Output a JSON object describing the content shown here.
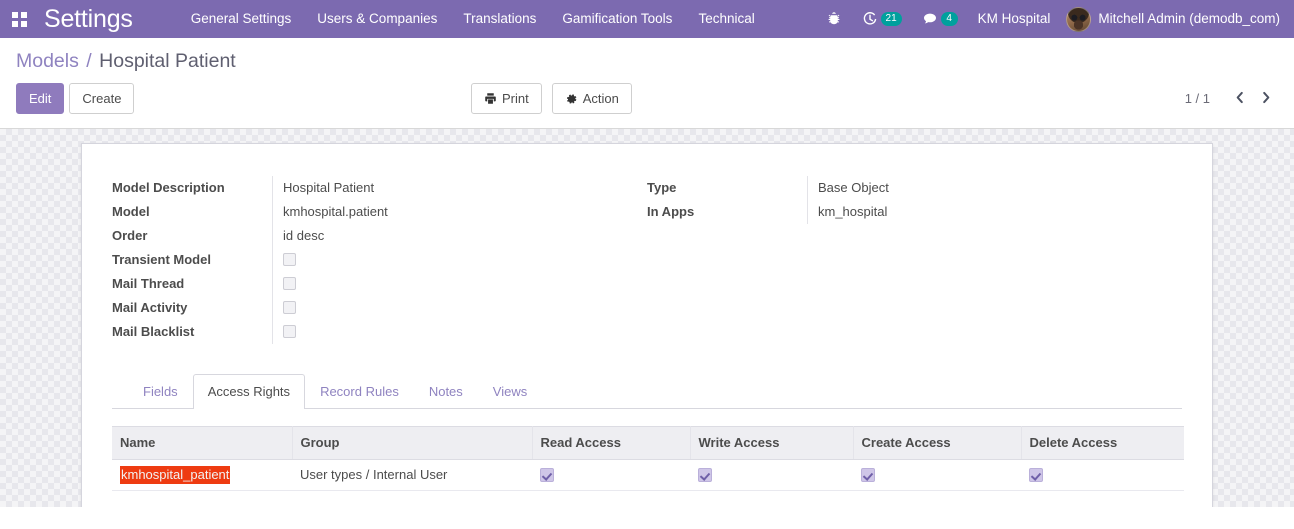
{
  "navbar": {
    "apps_icon": "apps-grid-icon",
    "brand": "Settings",
    "menu_items": [
      {
        "label": "General Settings"
      },
      {
        "label": "Users & Companies"
      },
      {
        "label": "Translations"
      },
      {
        "label": "Gamification Tools"
      },
      {
        "label": "Technical"
      }
    ],
    "systray": {
      "debug_icon": "bug-icon",
      "activity_icon": "clock-icon",
      "activity_count": "21",
      "messaging_icon": "chat-bubble-icon",
      "messaging_count": "4",
      "company": "KM Hospital",
      "user_name": "Mitchell Admin (demodb_com)",
      "avatar": "user-avatar",
      "badge_color": "#00a09d"
    },
    "background_color": "#7c6ab0"
  },
  "control_panel": {
    "breadcrumb": {
      "parent": "Models",
      "separator": "/",
      "current": "Hospital Patient"
    },
    "edit_label": "Edit",
    "create_label": "Create",
    "print_label": "Print",
    "print_icon": "printer-icon",
    "action_label": "Action",
    "action_icon": "gear-icon",
    "pager": {
      "value": "1 / 1",
      "previous_icon": "chevron-left-icon",
      "next_icon": "chevron-right-icon"
    }
  },
  "form": {
    "left_fields": [
      {
        "label": "Model Description",
        "value": "Hospital Patient",
        "type": "text"
      },
      {
        "label": "Model",
        "value": "kmhospital.patient",
        "type": "text"
      },
      {
        "label": "Order",
        "value": "id desc",
        "type": "text"
      },
      {
        "label": "Transient Model",
        "value": "",
        "type": "checkbox",
        "checked": false
      },
      {
        "label": "Mail Thread",
        "value": "",
        "type": "checkbox",
        "checked": false
      },
      {
        "label": "Mail Activity",
        "value": "",
        "type": "checkbox",
        "checked": false
      },
      {
        "label": "Mail Blacklist",
        "value": "",
        "type": "checkbox",
        "checked": false
      }
    ],
    "right_fields": [
      {
        "label": "Type",
        "value": "Base Object",
        "type": "text"
      },
      {
        "label": "In Apps",
        "value": "km_hospital",
        "type": "text"
      }
    ]
  },
  "notebook": {
    "tabs": [
      {
        "label": "Fields",
        "active": false
      },
      {
        "label": "Access Rights",
        "active": true
      },
      {
        "label": "Record Rules",
        "active": false
      },
      {
        "label": "Notes",
        "active": false
      },
      {
        "label": "Views",
        "active": false
      }
    ],
    "access_rights": {
      "columns": [
        "Name",
        "Group",
        "Read Access",
        "Write Access",
        "Create Access",
        "Delete Access"
      ],
      "rows": [
        {
          "name": "kmhospital_patient",
          "name_highlighted": true,
          "highlight_color": "#ee3b11",
          "group": "User types / Internal User",
          "read_access": true,
          "write_access": true,
          "create_access": true,
          "delete_access": true
        }
      ]
    }
  }
}
